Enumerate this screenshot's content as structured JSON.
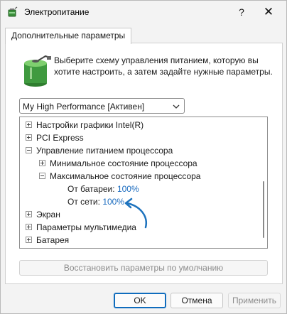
{
  "window": {
    "title": "Электропитание",
    "help_glyph": "?",
    "close_glyph": "✕",
    "icon": "power-options-icon"
  },
  "tab": {
    "label": "Дополнительные параметры"
  },
  "description": "Выберите схему управления питанием, которую вы хотите настроить, а затем задайте нужные параметры.",
  "scheme": {
    "selected": "My High Performance [Активен]"
  },
  "tree": [
    {
      "label": "Настройки графики Intel(R)",
      "state": "plus"
    },
    {
      "label": "PCI Express",
      "state": "plus"
    },
    {
      "label": "Управление питанием процессора",
      "state": "minus"
    },
    {
      "label": "Минимальное состояние процессора",
      "state": "plus"
    },
    {
      "label": "Максимальное состояние процессора",
      "state": "minus"
    },
    {
      "label": "От батареи:",
      "value": "100%"
    },
    {
      "label": "От сети:",
      "value": "100%"
    },
    {
      "label": "Экран",
      "state": "plus"
    },
    {
      "label": "Параметры мультимедиа",
      "state": "plus"
    },
    {
      "label": "Батарея",
      "state": "plus"
    }
  ],
  "restore_label": "Восстановить параметры по умолчанию",
  "buttons": {
    "ok": "OK",
    "cancel": "Отмена",
    "apply": "Применить"
  },
  "colors": {
    "accent": "#0f6cbd",
    "value_link": "#1a6bbf",
    "arrow": "#1e73be"
  }
}
